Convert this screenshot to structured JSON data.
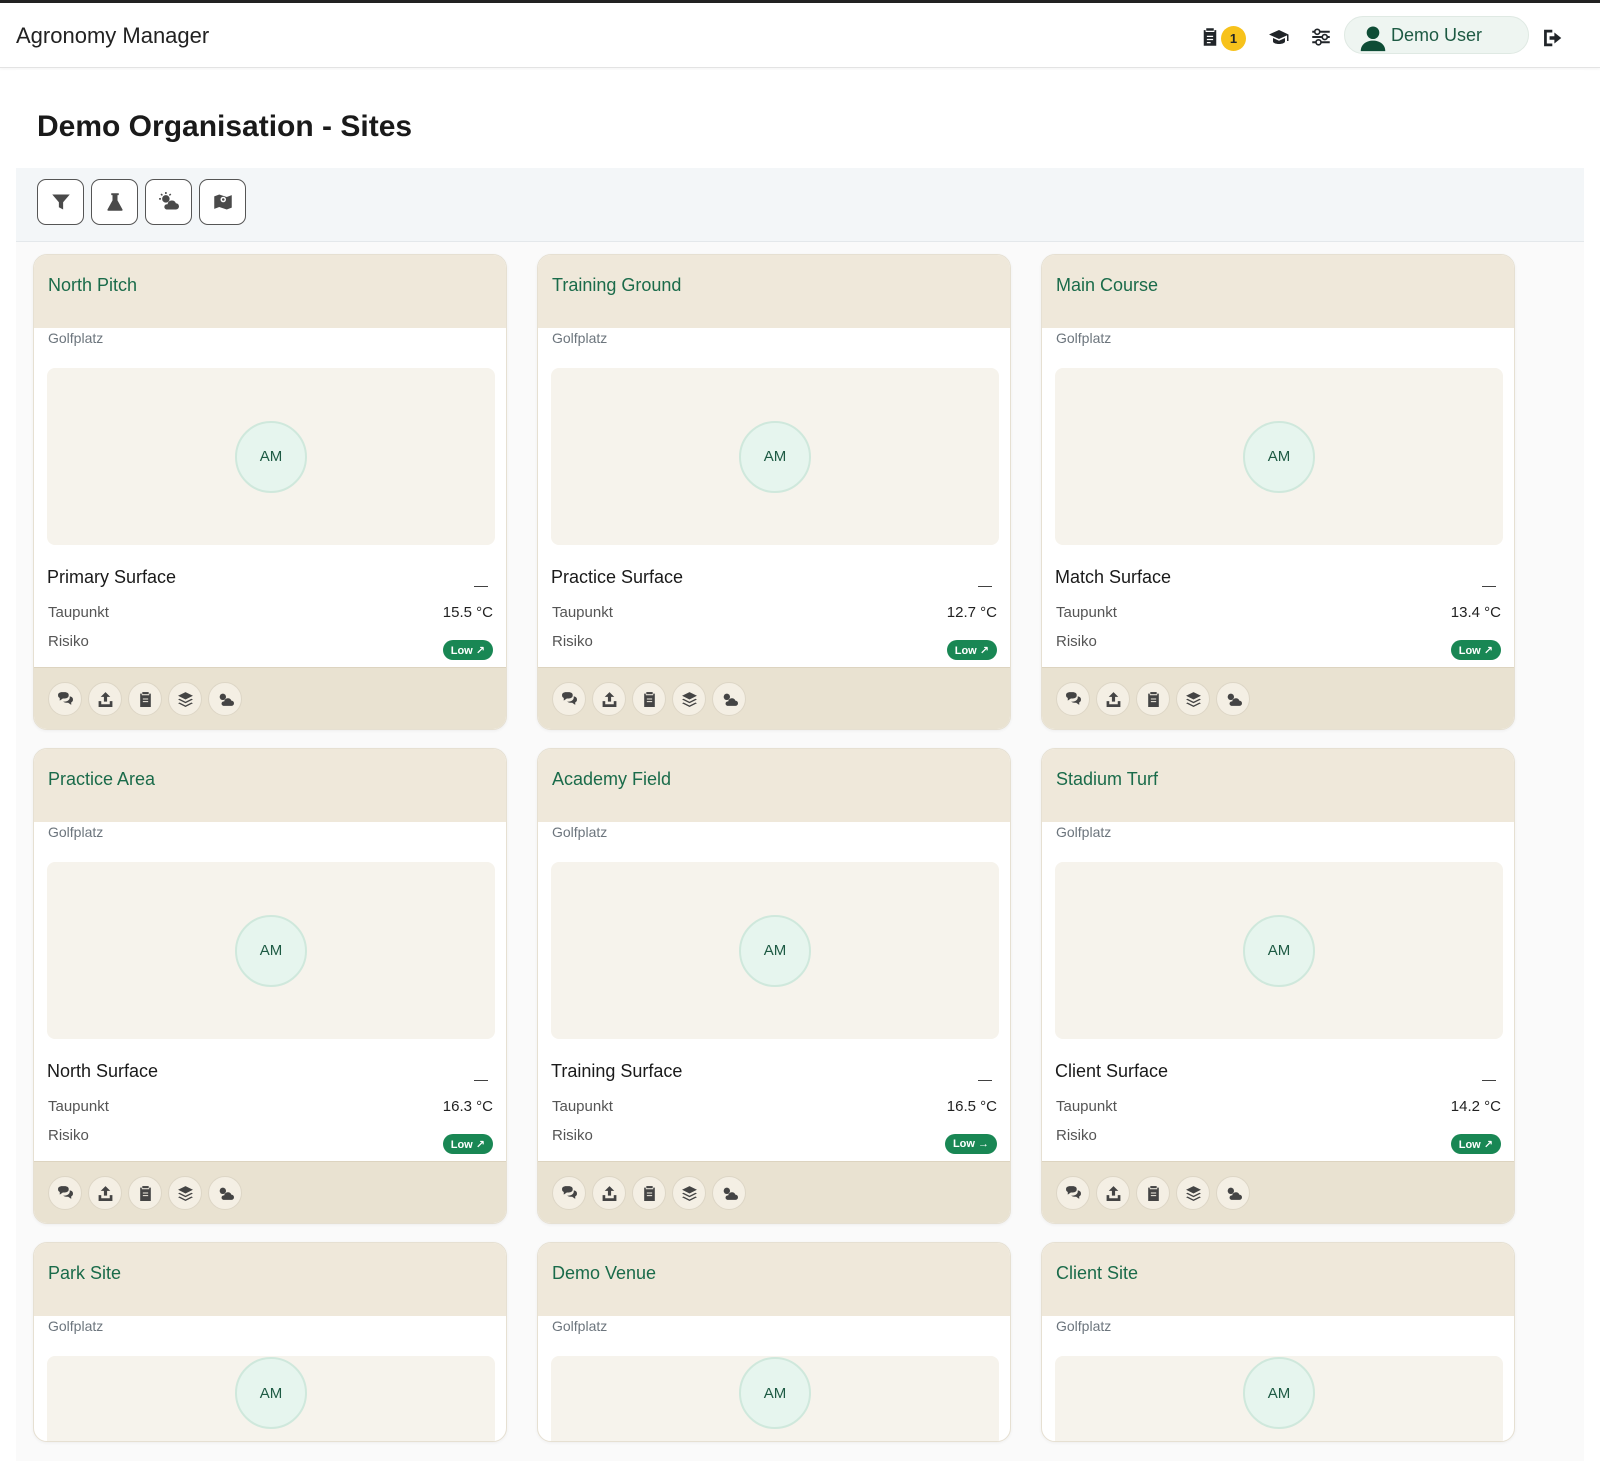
{
  "app": {
    "title": "Agronomy Manager"
  },
  "nav": {
    "badge_count": "1",
    "user_name": "Demo User",
    "icons": [
      "clipboard-icon",
      "graduation-cap-icon",
      "sliders-icon",
      "user-icon",
      "sign-out-icon"
    ]
  },
  "page": {
    "title": "Demo Organisation - Sites"
  },
  "toolbar": {
    "buttons": [
      "filter-icon",
      "flask-icon",
      "cloud-sun-icon",
      "map-icon"
    ]
  },
  "labels": {
    "type": "Golfplatz",
    "initials": "AM",
    "taupunkt": "Taupunkt",
    "risiko": "Risiko",
    "dash": "—"
  },
  "accent_color": "#1a6b4a",
  "risk_color": "#198754",
  "sites": [
    {
      "name": "North Pitch",
      "surface": "Primary Surface",
      "taupunkt": "15.5 °C",
      "risk": "Low ↗"
    },
    {
      "name": "Training Ground",
      "surface": "Practice Surface",
      "taupunkt": "12.7 °C",
      "risk": "Low ↗"
    },
    {
      "name": "Main Course",
      "surface": "Match Surface",
      "taupunkt": "13.4 °C",
      "risk": "Low ↗"
    },
    {
      "name": "Practice Area",
      "surface": "North Surface",
      "taupunkt": "16.3 °C",
      "risk": "Low ↗"
    },
    {
      "name": "Academy Field",
      "surface": "Training Surface",
      "taupunkt": "16.5 °C",
      "risk": "Low →"
    },
    {
      "name": "Stadium Turf",
      "surface": "Client Surface",
      "taupunkt": "14.2 °C",
      "risk": "Low ↗"
    },
    {
      "name": "Park Site"
    },
    {
      "name": "Demo Venue"
    },
    {
      "name": "Client Site"
    }
  ],
  "card_actions": [
    "comments-icon",
    "upload-icon",
    "clipboard-icon",
    "layers-icon",
    "cloud-sun-icon"
  ]
}
